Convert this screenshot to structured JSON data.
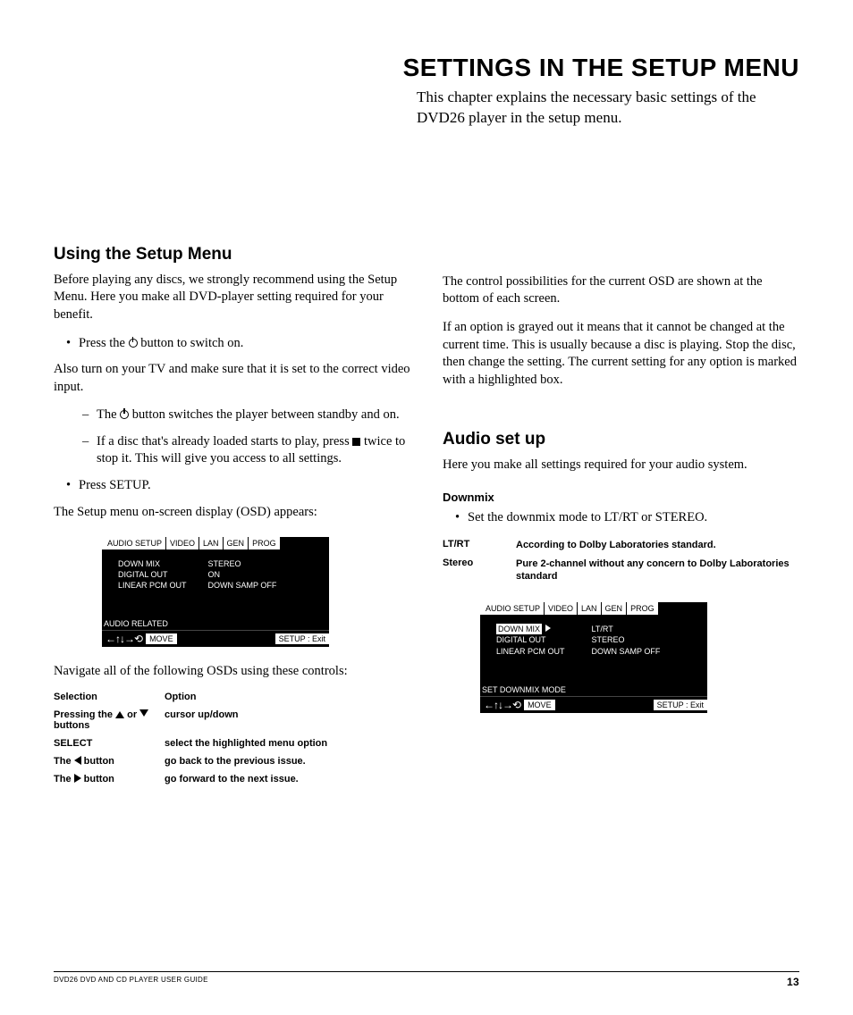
{
  "title": "SETTINGS IN THE SETUP MENU",
  "intro": "This chapter explains the necessary basic settings of the DVD26 player in the setup menu.",
  "left": {
    "h2": "Using the Setup Menu",
    "p1": "Before playing any discs, we strongly recommend using the Setup Menu. Here you make all DVD-player setting required for your benefit.",
    "b1a": "Press the ",
    "b1b": " button to switch on.",
    "p2": "Also turn on your TV and make sure that it is set to the correct video input.",
    "d1a": "The ",
    "d1b": " button switches the player between standby and on.",
    "d2a": "If a disc that's already loaded starts to play, press ",
    "d2b": " twice to stop it. This will give you access to all settings.",
    "b2": "Press SETUP.",
    "p3": "The Setup menu on-screen display (OSD) appears:",
    "p4": "Navigate all of the following OSDs using these controls:",
    "ctrl_head_sel": "Selection",
    "ctrl_head_opt": "Option",
    "ctrl_r1_sel_a": "Pressing the ",
    "ctrl_r1_sel_b": " or ",
    "ctrl_r1_sel_c": " buttons",
    "ctrl_r1_opt": "cursor up/down",
    "ctrl_r2_sel": "SELECT",
    "ctrl_r2_opt": "select the highlighted menu option",
    "ctrl_r3_sel_a": "The ",
    "ctrl_r3_sel_b": " button",
    "ctrl_r3_opt": "go back to the previous issue.",
    "ctrl_r4_sel_a": "The ",
    "ctrl_r4_sel_b": " button",
    "ctrl_r4_opt": "go forward to the next issue."
  },
  "right": {
    "p1": "The control possibilities for the current OSD are shown at the bottom of each screen.",
    "p2": "If an option is grayed out it means that it cannot be changed at the current time. This is usually because a disc is playing. Stop the disc, then change the setting. The current setting for any option is marked with a highlighted box.",
    "h2": "Audio set up",
    "p3": "Here you make all settings required for your audio system.",
    "h3": "Downmix",
    "b1": "Set the downmix mode to LT/RT or STEREO.",
    "dm1k": "LT/RT",
    "dm1v": "According to Dolby Laboratories standard.",
    "dm2k": "Stereo",
    "dm2v": "Pure 2-channel without any concern to Dolby Laboratories standard"
  },
  "osd1": {
    "tabs": [
      "AUDIO SETUP",
      "VIDEO",
      "LAN",
      "GEN",
      "PROG"
    ],
    "col1": [
      "DOWN MIX",
      "DIGITAL OUT",
      "LINEAR PCM OUT"
    ],
    "col2": [
      "STEREO",
      "ON",
      "DOWN SAMP OFF"
    ],
    "status": "AUDIO RELATED",
    "move": "MOVE",
    "exit": "SETUP : Exit"
  },
  "osd2": {
    "tabs": [
      "AUDIO SETUP",
      "VIDEO",
      "LAN",
      "GEN",
      "PROG"
    ],
    "col1": [
      "DOWN MIX",
      "DIGITAL OUT",
      "LINEAR PCM OUT"
    ],
    "col2": [
      "LT/RT",
      "STEREO",
      "DOWN SAMP OFF"
    ],
    "status": "SET DOWNMIX MODE",
    "move": "MOVE",
    "exit": "SETUP : Exit"
  },
  "footer": {
    "guide": "DVD26 DVD AND CD PLAYER USER GUIDE",
    "page": "13"
  }
}
